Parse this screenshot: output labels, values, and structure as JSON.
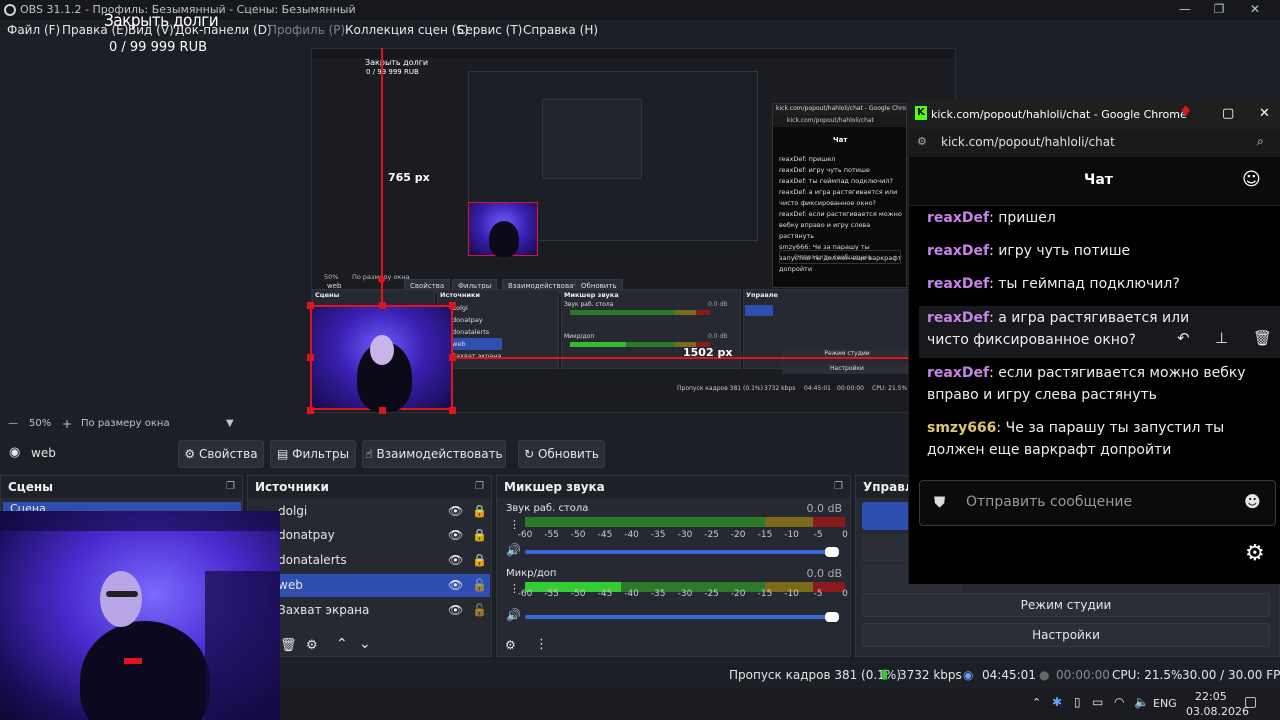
{
  "titlebar": {
    "title": "OBS 31.1.2 - Профиль: Безымянный - Сцены: Безымянный",
    "min": "—",
    "max": "❐",
    "close": "✕"
  },
  "menu": [
    "Файл (F)",
    "Правка (E)",
    "Вид (V)",
    "Док-панели (D)",
    "Профиль (P)",
    "Коллекция сцен (S)",
    "Сервис (T)",
    "Справка (H)"
  ],
  "overlay": {
    "title": "Закрыть долги",
    "amount": "0 / 99 999 RUB"
  },
  "nested": {
    "overlay_title": "Закрыть долги",
    "overlay_amount": "0 / 99 999 RUB",
    "height_label": "765 px",
    "width_label": "1502 px",
    "chat_window_title": "kick.com/popout/hahloli/chat - Google Chrome",
    "chat_url": "kick.com/popout/hahloli/chat",
    "chat_header": "Чат",
    "chat_lines": [
      "reaxDef: пришел",
      "reaxDef: игру чуть потише",
      "reaxDef: ты геймпад подключил?",
      "reaxDef: а игра растягивается или чисто фиксированное окно?",
      "reaxDef: если растягивается можно вебку вправо и игру слева растянуть",
      "smzy666: Че за парашу ты запустил ты должен еще варкрафт допройти"
    ],
    "chat_input": "Отправить сообщение",
    "toolbar_source": "web",
    "btn_props": "Свойства",
    "btn_filters": "Фильтры",
    "btn_interact": "Взаимодействовать",
    "btn_refresh": "Обновить",
    "scenes": "Сцены",
    "sources": "Источники",
    "mixer": "Микшер звука",
    "controls": "Управле",
    "src_items": [
      "dolgi",
      "donatpay",
      "donatalerts",
      "web",
      "Захват экрана"
    ],
    "desktop_audio": "Звук раб. стола",
    "mic": "Микр/доп",
    "db": "0.0 dB",
    "studio": "Режим студии",
    "settings": "Настройки",
    "status": "Пропуск кадров 381 (0.1%)",
    "kbps": "3732 kbps",
    "time": "04:45:01",
    "rec": "00:00:00",
    "cpu": "CPU: 21.5%",
    "zoom": "50%",
    "fit": "По размеру окна"
  },
  "zoombar": {
    "minus": "—",
    "zoom": "50%",
    "plus": "+",
    "fit": "По размеру окна"
  },
  "toolbar": {
    "source_name": "web",
    "props": "Свойства",
    "filters": "Фильтры",
    "interact": "Взаимодействовать",
    "refresh": "Обновить"
  },
  "docks": {
    "scenes": {
      "title": "Сцены",
      "items": [
        "Сцена"
      ]
    },
    "sources": {
      "title": "Источники",
      "items": [
        "dolgi",
        "donatpay",
        "donatalerts",
        "web",
        "Захват экрана"
      ]
    },
    "mixer": {
      "title": "Микшер звука",
      "channels": [
        {
          "name": "Звук раб. стола",
          "db": "0.0 dB"
        },
        {
          "name": "Микр/доп",
          "db": "0.0 dB"
        }
      ],
      "scale": [
        "-60",
        "-55",
        "-50",
        "-45",
        "-40",
        "-35",
        "-30",
        "-25",
        "-20",
        "-15",
        "-10",
        "-5",
        "0"
      ]
    },
    "controls": {
      "title": "Управле",
      "studio": "Режим студии",
      "settings": "Настройки"
    }
  },
  "status": {
    "dropped": "Пропуск кадров 381 (0.1%)",
    "kbps": "3732 kbps",
    "stream_time": "04:45:01",
    "rec_time": "00:00:00",
    "cpu": "CPU: 21.5%",
    "fps": "30.00 / 30.00 FPS"
  },
  "taskbar": {
    "lang": "ENG",
    "time": "22:05",
    "date": "03.08.2026"
  },
  "chat": {
    "window_title": "kick.com/popout/hahloli/chat - Google Chrome",
    "url": "kick.com/popout/hahloli/chat",
    "header": "Чат",
    "messages": [
      {
        "user": "reaxDef",
        "text": "пришел"
      },
      {
        "user": "reaxDef",
        "text": "игру чуть потише"
      },
      {
        "user": "reaxDef",
        "text": "ты геймпад подключил?"
      },
      {
        "user": "reaxDef",
        "text": "а игра растягивается или чисто фиксированное окно?"
      },
      {
        "user": "reaxDef",
        "text": "если растягивается можно вебку вправо и игру слева растянуть"
      },
      {
        "user": "smzy666",
        "text": "Че за парашу ты запустил ты должен еще варкрафт допройти"
      }
    ],
    "input_placeholder": "Отправить сообщение"
  },
  "colors": {
    "accent": "#2f4fb0",
    "chat_user": "#c783e8",
    "chat_user_alt": "#e3c66a",
    "red_guides": "#e0141e"
  }
}
